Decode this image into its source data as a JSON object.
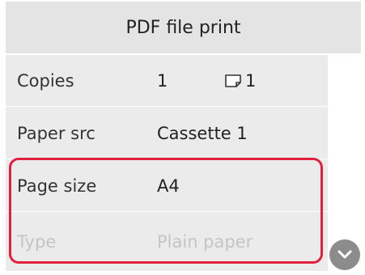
{
  "header": {
    "title": "PDF file print"
  },
  "settings": {
    "copies": {
      "label": "Copies",
      "value": "1",
      "sheets_icon": "paper-sheet-icon",
      "sheets_value": "1"
    },
    "paper_src": {
      "label": "Paper src",
      "value": "Cassette 1"
    },
    "page_size": {
      "label": "Page size",
      "value": "A4"
    },
    "type": {
      "label": "Type",
      "value": "Plain paper",
      "state": "disabled"
    }
  },
  "scroll": {
    "icon": "chevron-down-icon"
  },
  "colors": {
    "highlight": "#e0203c",
    "header_bg": "#e4e4e4",
    "panel_bg": "#ebebeb",
    "disabled_text": "#c4c4c4"
  }
}
